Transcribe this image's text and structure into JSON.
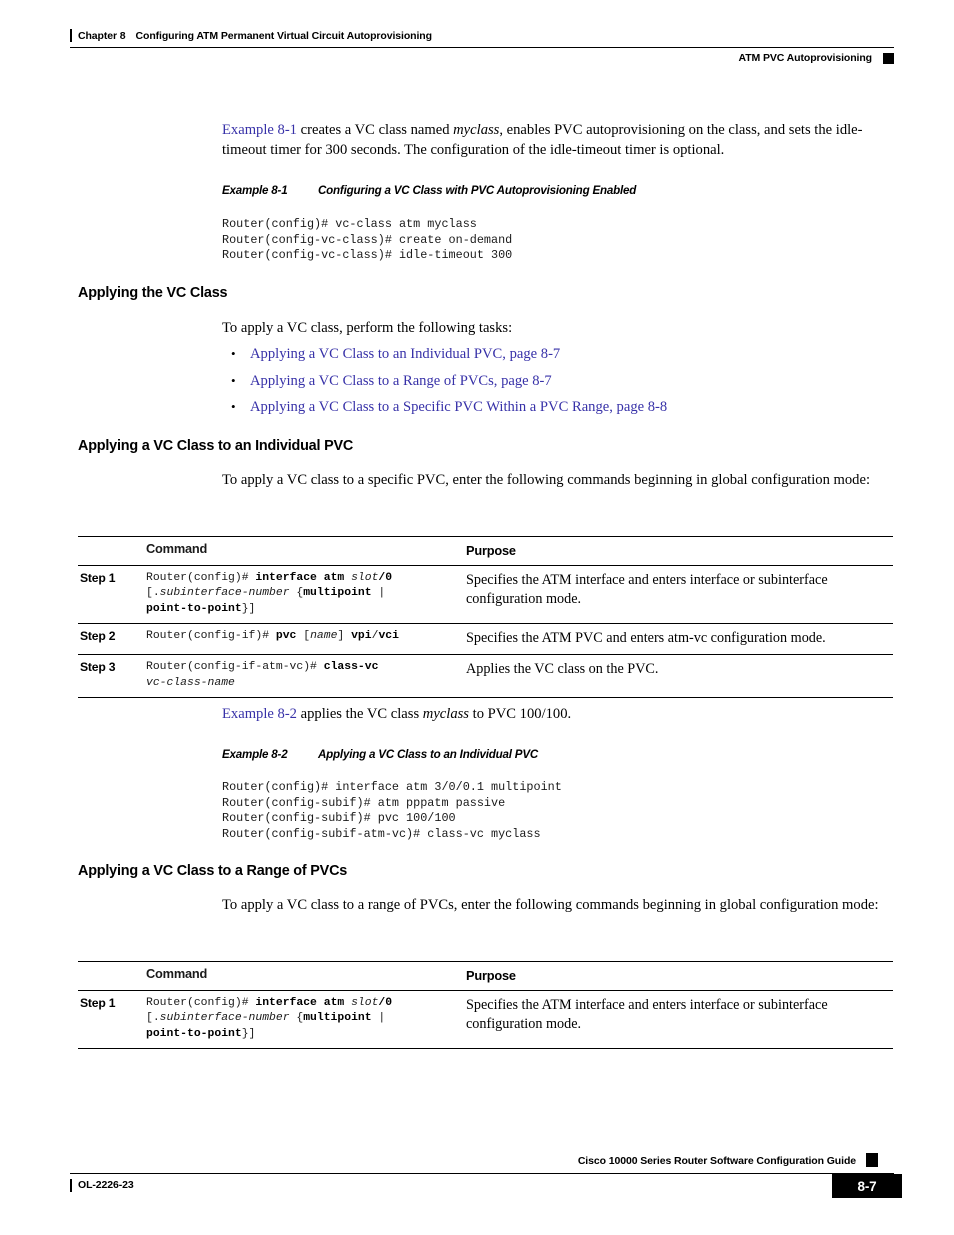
{
  "header": {
    "chapter_label": "Chapter 8",
    "chapter_title": "Configuring ATM Permanent Virtual Circuit Autoprovisioning",
    "section_title": "ATM PVC Autoprovisioning"
  },
  "intro": {
    "link_text": "Example 8-1",
    "rest": " creates a VC class named ",
    "italic_term": "myclass",
    "rest2": ", enables PVC autoprovisioning on the class, and sets the idle-timeout timer for 300 seconds. The configuration of the idle-timeout timer is optional."
  },
  "example1": {
    "number": "Example 8-1",
    "title": "Configuring a VC Class with PVC Autoprovisioning Enabled",
    "code": "Router(config)# vc-class atm myclass\nRouter(config-vc-class)# create on-demand\nRouter(config-vc-class)# idle-timeout 300"
  },
  "applying_vc_class": {
    "heading": "Applying the VC Class",
    "lead_in": "To apply a VC class, perform the following tasks:",
    "bullet_char": "•",
    "links": [
      "Applying a VC Class to an Individual PVC, page 8-7",
      "Applying a VC Class to a Range of PVCs, page 8-7",
      "Applying a VC Class to a Specific PVC Within a PVC Range, page 8-8"
    ]
  },
  "individual_pvc": {
    "heading": "Applying a VC Class to an Individual PVC",
    "lead_in": "To apply a VC class to a specific PVC, enter the following commands beginning in global configuration mode:"
  },
  "table1": {
    "columns": [
      "",
      "Command",
      "Purpose"
    ],
    "rows": [
      {
        "step": "Step 1",
        "command_parts": [
          {
            "t": "Router(config)# ",
            "s": "plain"
          },
          {
            "t": "interface atm ",
            "s": "bold"
          },
          {
            "t": "slot",
            "s": "italic"
          },
          {
            "t": "/0",
            "s": "bold"
          },
          {
            "t": "\n[.",
            "s": "plain"
          },
          {
            "t": "subinterface-number",
            "s": "italic"
          },
          {
            "t": " {",
            "s": "plain"
          },
          {
            "t": "multipoint",
            "s": "bold"
          },
          {
            "t": " |\n",
            "s": "plain"
          },
          {
            "t": "point-to-point",
            "s": "bold"
          },
          {
            "t": "}]",
            "s": "plain"
          }
        ],
        "purpose": "Specifies the ATM interface and enters interface or subinterface configuration mode."
      },
      {
        "step": "Step 2",
        "command_parts": [
          {
            "t": "Router(config-if)# ",
            "s": "plain"
          },
          {
            "t": "pvc ",
            "s": "bold"
          },
          {
            "t": "[",
            "s": "plain"
          },
          {
            "t": "name",
            "s": "italic"
          },
          {
            "t": "] ",
            "s": "plain"
          },
          {
            "t": "vpi",
            "s": "bold"
          },
          {
            "t": "/",
            "s": "plain"
          },
          {
            "t": "vci",
            "s": "bold"
          }
        ],
        "purpose": "Specifies the ATM PVC and enters atm-vc configuration mode."
      },
      {
        "step": "Step 3",
        "command_parts": [
          {
            "t": "Router(config-if-atm-vc)# ",
            "s": "plain"
          },
          {
            "t": "class-vc",
            "s": "bold"
          },
          {
            "t": "\n",
            "s": "plain"
          },
          {
            "t": "vc-class-name",
            "s": "italic"
          }
        ],
        "purpose": "Applies the VC class on the PVC."
      }
    ]
  },
  "example2_intro": {
    "link_text": "Example 8-2",
    "rest": " applies the VC class ",
    "italic_term": "myclass",
    "rest2": " to PVC 100/100."
  },
  "example2": {
    "number": "Example 8-2",
    "title": "Applying a VC Class to an Individual PVC",
    "code": "Router(config)# interface atm 3/0/0.1 multipoint\nRouter(config-subif)# atm pppatm passive\nRouter(config-subif)# pvc 100/100\nRouter(config-subif-atm-vc)# class-vc myclass"
  },
  "range_pvcs": {
    "heading": "Applying a VC Class to a Range of PVCs",
    "lead_in": "To apply a VC class to a range of PVCs, enter the following commands beginning in global configuration mode:"
  },
  "table2": {
    "columns": [
      "",
      "Command",
      "Purpose"
    ],
    "rows": [
      {
        "step": "Step 1",
        "command_parts": [
          {
            "t": "Router(config)# ",
            "s": "plain"
          },
          {
            "t": "interface atm ",
            "s": "bold"
          },
          {
            "t": "slot",
            "s": "italic"
          },
          {
            "t": "/0",
            "s": "bold"
          },
          {
            "t": "\n[.",
            "s": "plain"
          },
          {
            "t": "subinterface-number",
            "s": "italic"
          },
          {
            "t": " {",
            "s": "plain"
          },
          {
            "t": "multipoint",
            "s": "bold"
          },
          {
            "t": " |\n",
            "s": "plain"
          },
          {
            "t": "point-to-point",
            "s": "bold"
          },
          {
            "t": "}]",
            "s": "plain"
          }
        ],
        "purpose": "Specifies the ATM interface and enters interface or subinterface configuration mode."
      }
    ]
  },
  "footer": {
    "guide_title": "Cisco 10000 Series Router Software Configuration Guide",
    "doc_id": "OL-2226-23",
    "page_number": "8-7"
  },
  "colors": {
    "link": "#3731a8",
    "rule": "#000000",
    "page_box": "#000000"
  }
}
